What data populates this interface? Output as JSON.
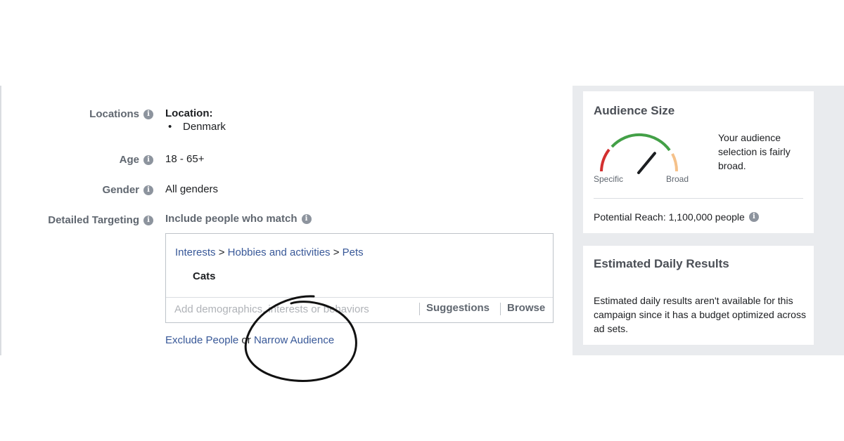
{
  "form": {
    "locations": {
      "label": "Locations",
      "heading": "Location:",
      "bullet": "•",
      "items": [
        "Denmark"
      ]
    },
    "age": {
      "label": "Age",
      "value": "18 - 65+"
    },
    "gender": {
      "label": "Gender",
      "value": "All genders"
    },
    "detailed_targeting": {
      "label": "Detailed Targeting",
      "include_title": "Include people who match",
      "breadcrumb": [
        {
          "text": "Interests"
        },
        {
          "text": "Hobbies and activities"
        },
        {
          "text": "Pets"
        }
      ],
      "breadcrumb_sep": ">",
      "selected": "Cats",
      "input_placeholder": "Add demographics, interests or behaviors",
      "suggestions_label": "Suggestions",
      "browse_label": "Browse"
    },
    "links": {
      "exclude": "Exclude People",
      "or": "or",
      "narrow": "Narrow Audience"
    }
  },
  "audience_size": {
    "title": "Audience Size",
    "gauge": {
      "left_label": "Specific",
      "right_label": "Broad",
      "level": 0.72
    },
    "description": "Your audience selection is fairly broad.",
    "potential_reach": "Potential Reach: 1,100,000 people"
  },
  "estimated_daily": {
    "title": "Estimated Daily Results",
    "description": "Estimated daily results aren't available for this campaign since it has a budget optimized across ad sets."
  },
  "icons": {
    "info": "info-icon"
  },
  "colors": {
    "link": "#385898",
    "gauge_red": "#d32f2f",
    "gauge_green": "#43a047",
    "gauge_peach": "#f5c18a",
    "sidebar_bg": "#e9ebee"
  }
}
